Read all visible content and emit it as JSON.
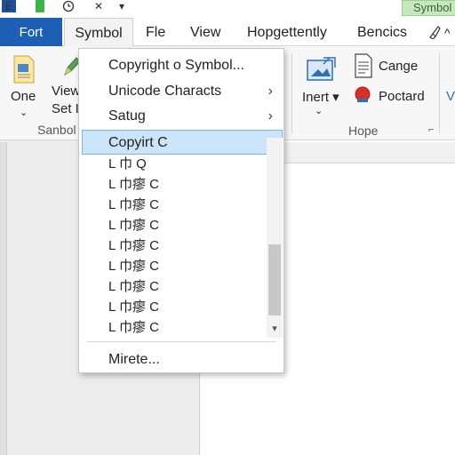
{
  "quick_access": {
    "close_glyph": "✕",
    "down_glyph": "▾",
    "title_tag": "Symbol"
  },
  "tabs": {
    "file": "Fort",
    "symbol": "Symbol",
    "file2": "Fle",
    "view": "View",
    "hop": "Hopgettently",
    "bencics": "Bencics",
    "more": "^"
  },
  "ribbon": {
    "one_label": "One",
    "view_label": "View",
    "set_label": "Set I",
    "group_sanbol": "Sanbol",
    "inert_label": "Inert ▾",
    "cange_label": "Cange",
    "poctard_label": "Poctard",
    "group_hope": "Hope",
    "partial_label": "V",
    "dialog_glyph": "⌐"
  },
  "menu": {
    "items": [
      {
        "label": "Copyright o Symbol...",
        "arrow": ""
      },
      {
        "label": "Unicode Characts",
        "arrow": "›"
      },
      {
        "label": "Satug",
        "arrow": "›"
      }
    ],
    "selected": "Copyirt C",
    "symbol_rows": [
      "L 巾 Q",
      "L 巾瘳 C",
      "L 巾瘳 C",
      "L 巾瘳 C",
      "L 巾瘳 C",
      "L 巾瘳 C",
      "L 巾瘳 C",
      "L 巾瘳 C",
      "L 巾瘳 C"
    ],
    "more": "Mirete...",
    "scroll_down_glyph": "▾"
  },
  "colors": {
    "file_tab": "#1d5fb4",
    "selected_bg": "#cce4f7",
    "title_tag": "#c8e6c0"
  }
}
